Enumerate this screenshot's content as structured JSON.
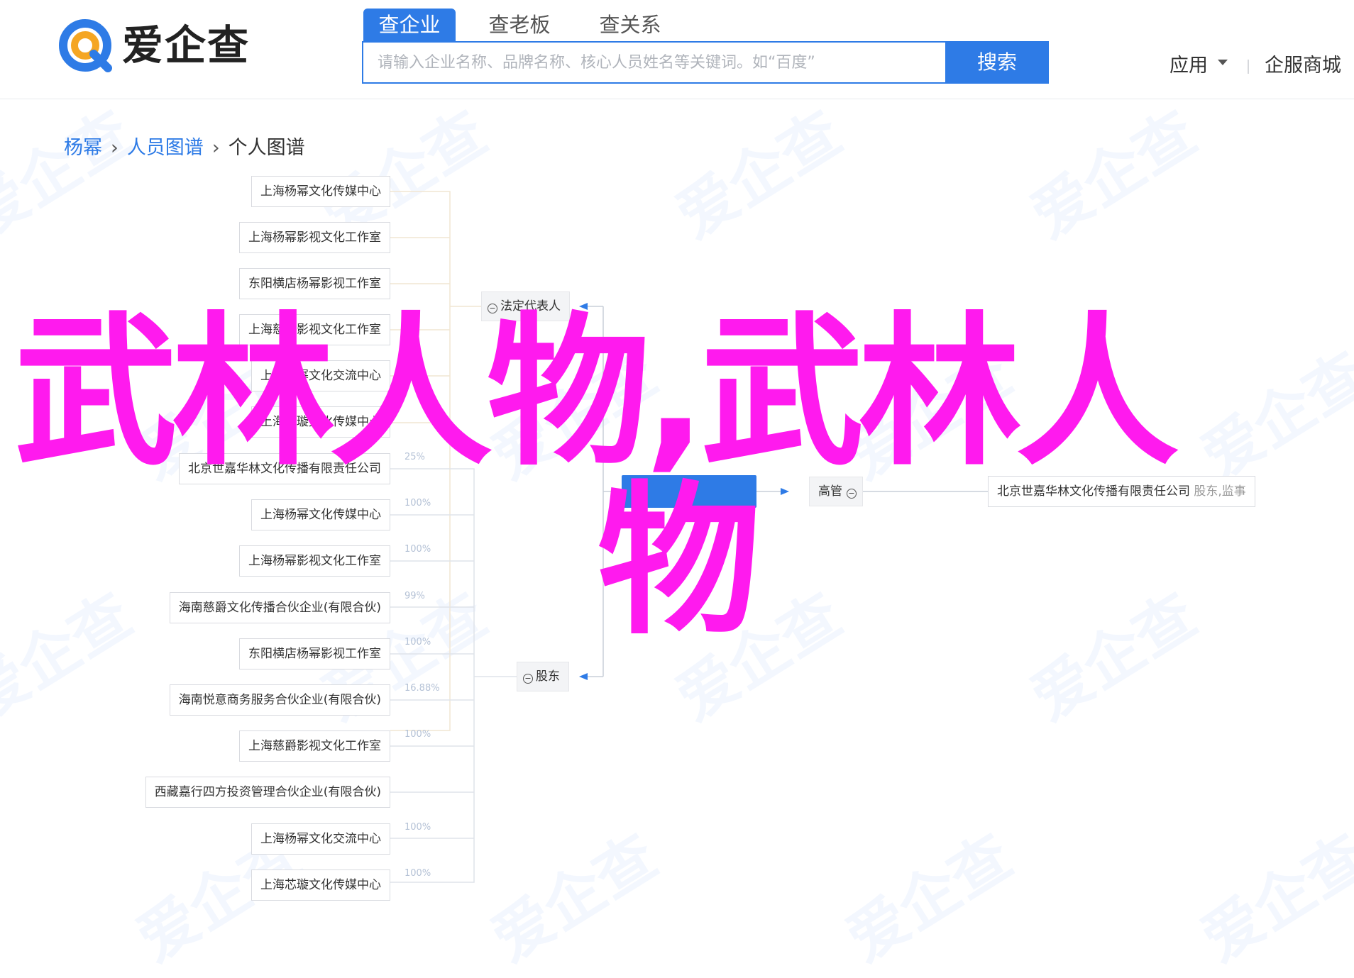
{
  "header": {
    "logo_text": "爱企查",
    "tabs": [
      {
        "label": "查企业",
        "active": true
      },
      {
        "label": "查老板",
        "active": false
      },
      {
        "label": "查关系",
        "active": false
      }
    ],
    "search": {
      "placeholder": "请输入企业名称、品牌名称、核心人员姓名等关键词。如“百度”",
      "value": "",
      "button_label": "搜索"
    },
    "apps_label": "应用",
    "store_label": "企服商城",
    "accent_color": "#2e7be6"
  },
  "watermark_text": "爱企查",
  "breadcrumb": {
    "items": [
      "杨幂",
      "人员图谱",
      "个人图谱"
    ]
  },
  "graph": {
    "legal_rep": {
      "label": "法定代表人",
      "companies": [
        "上海杨幂文化传媒中心",
        "上海杨幂影视文化工作室",
        "东阳横店杨幂影视工作室",
        "上海慈爵影视文化工作室",
        "上海杨幂文化交流中心",
        "上海芯璇文化传媒中心"
      ]
    },
    "shareholder": {
      "label": "股东",
      "companies": [
        {
          "name": "北京世嘉华林文化传播有限责任公司",
          "pct": "25%"
        },
        {
          "name": "上海杨幂文化传媒中心",
          "pct": "100%"
        },
        {
          "name": "上海杨幂影视文化工作室",
          "pct": "100%"
        },
        {
          "name": "海南慈爵文化传播合伙企业(有限合伙)",
          "pct": "99%"
        },
        {
          "name": "东阳横店杨幂影视工作室",
          "pct": "100%"
        },
        {
          "name": "海南悦意商务服务合伙企业(有限合伙)",
          "pct": "16.88%"
        },
        {
          "name": "上海慈爵影视文化工作室",
          "pct": "100%"
        },
        {
          "name": "西藏嘉行四方投资管理合伙企业(有限合伙)",
          "pct": ""
        },
        {
          "name": "上海杨幂文化交流中心",
          "pct": "100%"
        },
        {
          "name": "上海芯璇文化传媒中心",
          "pct": "100%"
        }
      ]
    },
    "executive": {
      "label": "高管",
      "company": "北京世嘉华林文化传播有限责任公司",
      "roles": "股东,监事"
    }
  },
  "overlay": {
    "line1": "武林人物,武林人",
    "line2": "物",
    "color": "#ff1aee"
  }
}
